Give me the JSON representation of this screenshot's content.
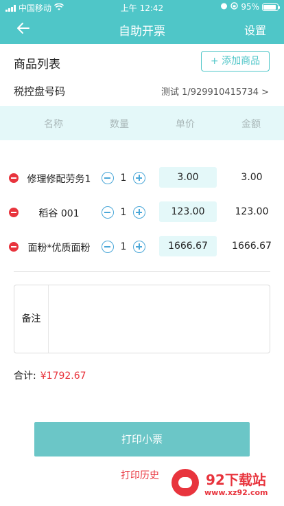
{
  "status_bar": {
    "carrier": "中国移动",
    "time": "上午 12:42",
    "battery": "95%"
  },
  "nav": {
    "title": "自助开票",
    "settings": "设置"
  },
  "goods": {
    "title": "商品列表",
    "add_button": "+ 添加商品"
  },
  "tax": {
    "label": "税控盘号码",
    "value": "测试 1/929910415734 >"
  },
  "table": {
    "columns": [
      "名称",
      "数量",
      "单价",
      "金额"
    ],
    "rows": [
      {
        "name": "修理修配劳务1",
        "qty": "1",
        "price": "3.00",
        "amount": "3.00"
      },
      {
        "name": "稻谷 001",
        "qty": "1",
        "price": "123.00",
        "amount": "123.00"
      },
      {
        "name": "面粉*优质面粉",
        "qty": "1",
        "price": "1666.67",
        "amount": "1666.67"
      }
    ]
  },
  "remark": {
    "label": "备注",
    "value": "",
    "placeholder": ""
  },
  "total": {
    "label": "合计:",
    "value": "¥1792.67"
  },
  "actions": {
    "print": "打印小票",
    "history": "打印历史"
  },
  "watermark": {
    "title": "92下载站",
    "url": "www.xz92.com"
  },
  "colors": {
    "primary": "#4fc6c8",
    "danger": "#e8343d",
    "table_header_bg": "#e4f8f9"
  }
}
